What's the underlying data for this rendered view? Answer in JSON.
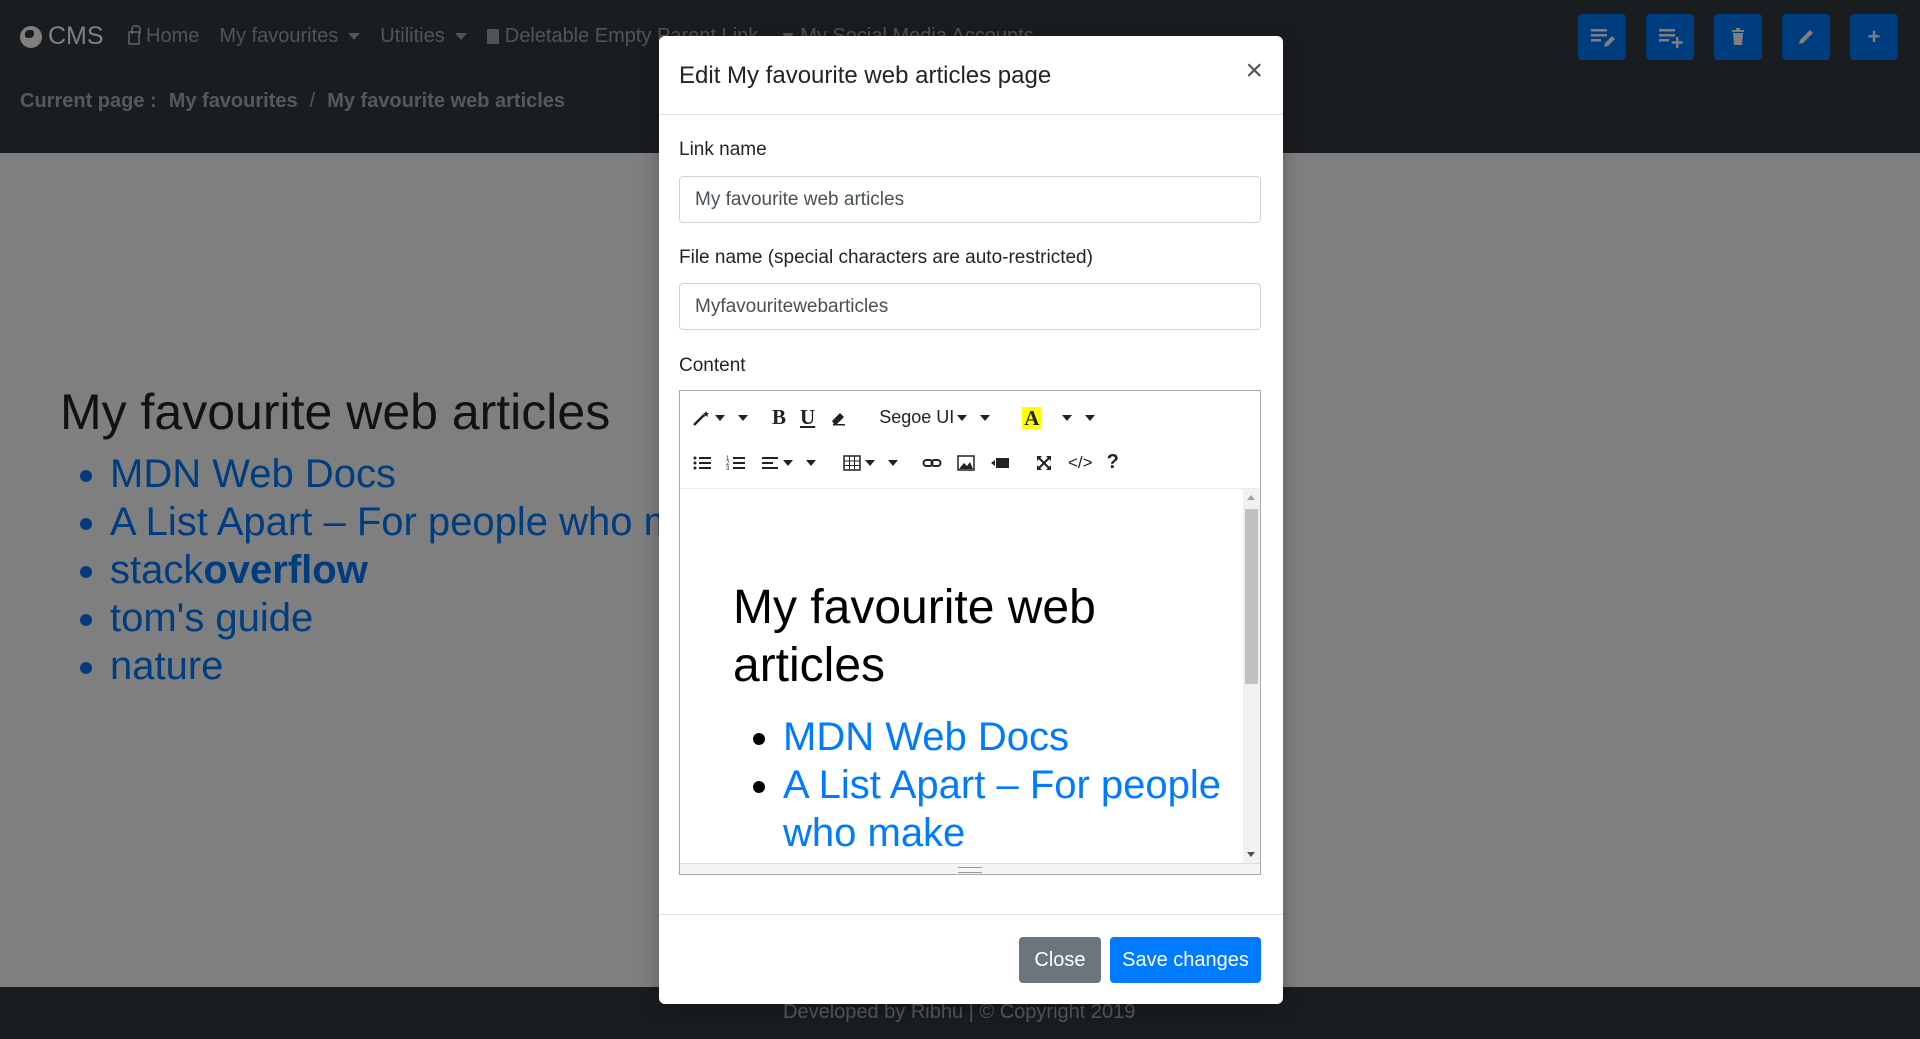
{
  "navbar": {
    "brand": "CMS",
    "links": [
      {
        "label": "Home"
      },
      {
        "label": "My favourites"
      },
      {
        "label": "Utilities"
      },
      {
        "label": "Deletable Empty Parent Link"
      },
      {
        "label": "My Social Media Accounts"
      }
    ],
    "breadcrumb": {
      "prefix": "Current page :",
      "parent": "My favourites",
      "separator": "/",
      "current": "My favourite web articles"
    },
    "tools": [
      {
        "icon": "edit-list-icon"
      },
      {
        "icon": "add-list-icon"
      },
      {
        "icon": "trash-icon"
      },
      {
        "icon": "pencil-icon"
      },
      {
        "icon": "plus-icon",
        "glyph": "+"
      }
    ]
  },
  "page": {
    "heading": "My favourite web articles",
    "links": [
      {
        "label": "MDN Web Docs"
      },
      {
        "label": "A List Apart – For people who make websites"
      },
      {
        "label_normal": "stack",
        "label_bold": "overflow"
      },
      {
        "label": "tom's guide"
      },
      {
        "label": "nature"
      }
    ]
  },
  "footer": {
    "text": "Developed by Ribhu | © Copyright 2019"
  },
  "modal": {
    "title": "Edit My favourite web articles page",
    "close_glyph": "×",
    "link_name_label": "Link name",
    "link_name_value": "My favourite web articles",
    "file_name_label": "File name (special characters are auto-restricted)",
    "file_name_value": "Myfavouritewebarticles",
    "content_label": "Content",
    "editor": {
      "font_name": "Segoe UI",
      "bold_glyph": "B",
      "underline_glyph": "U",
      "color_glyph": "A",
      "code_glyph": "</>",
      "help_glyph": "?",
      "heading": "My favourite web articles",
      "links": [
        {
          "label": "MDN Web Docs"
        },
        {
          "label": "A List Apart – For people who make"
        }
      ]
    },
    "close_button": "Close",
    "save_button": "Save changes"
  },
  "colors": {
    "navbar": "#343a40",
    "primary": "#007bff",
    "secondary": "#6c757d"
  }
}
